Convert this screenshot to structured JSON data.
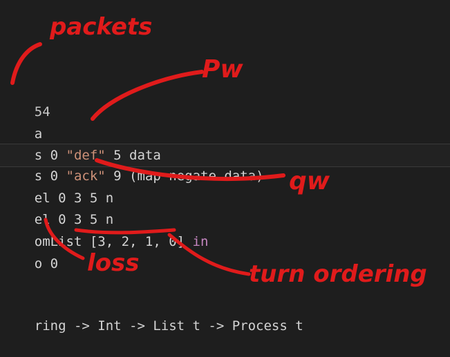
{
  "editor": {
    "lines": [
      {
        "parts": [
          "54"
        ]
      },
      {
        "parts": [
          "a"
        ]
      },
      {
        "parts": [
          "s 0 ",
          "\"def\"",
          " 5 data"
        ]
      },
      {
        "parts": [
          "s 0 ",
          "\"ack\"",
          " 9 (map negate data)"
        ]
      },
      {
        "parts": [
          "el 0 3 5 n"
        ]
      },
      {
        "parts": [
          "el 0 3 5 n"
        ]
      },
      {
        "parts": [
          "omList [3, 2, 1, 0] ",
          "in"
        ]
      },
      {
        "parts": [
          "o 0"
        ]
      },
      {
        "parts": [
          "ring -> Int -> List t -> Process t"
        ]
      }
    ]
  },
  "annotations": {
    "packets": "packets",
    "pw": "Pw",
    "qw": "qw",
    "loss": "loss",
    "turn_ordering": "turn ordering",
    "ink_color": "#e01b1b"
  }
}
